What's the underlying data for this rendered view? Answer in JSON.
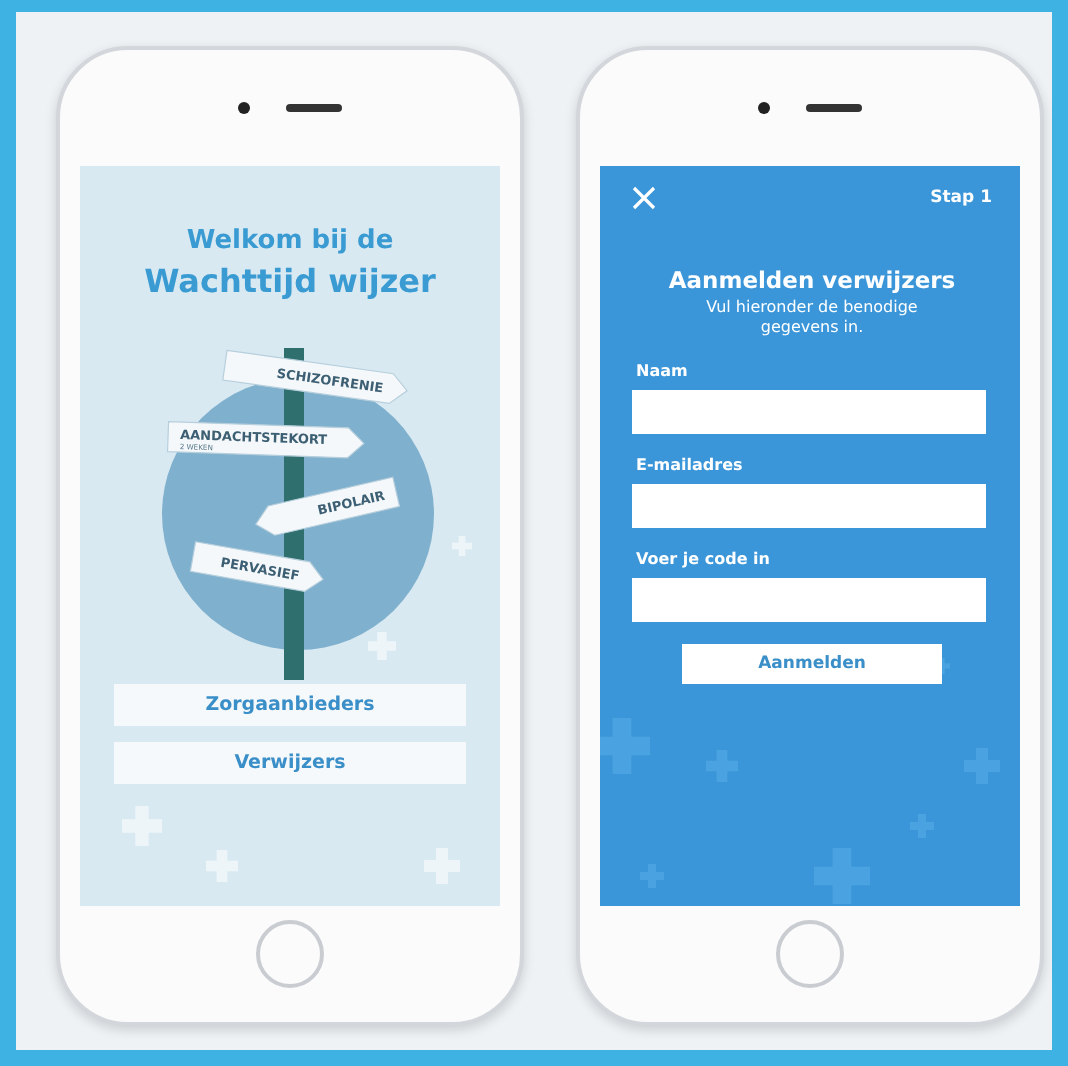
{
  "screens": [
    {
      "kind": "welcome",
      "title_line_1": "Welkom bij de",
      "title_line_2": "Wachttijd wijzer",
      "signs": [
        {
          "label": "SCHIZOFRENIE",
          "kind": "right"
        },
        {
          "label": "AANDACHTSTEKORT",
          "note": "2 WEKEN",
          "kind": "right"
        },
        {
          "label": "BIPOLAIR",
          "kind": "left"
        },
        {
          "label": "PERVASIEF",
          "kind": "right"
        }
      ],
      "buttons": [
        "Zorgaanbieders",
        "Verwijzers"
      ]
    },
    {
      "kind": "form",
      "step": "Stap 1",
      "title": "Aanmelden verwijzers",
      "subtitle": "Vul hieronder de benodige gegevens in.",
      "fields": [
        {
          "label": "Naam"
        },
        {
          "label": "E-mailadres"
        },
        {
          "label": "Voer je code in"
        }
      ],
      "submit": "Aanmelden"
    }
  ]
}
